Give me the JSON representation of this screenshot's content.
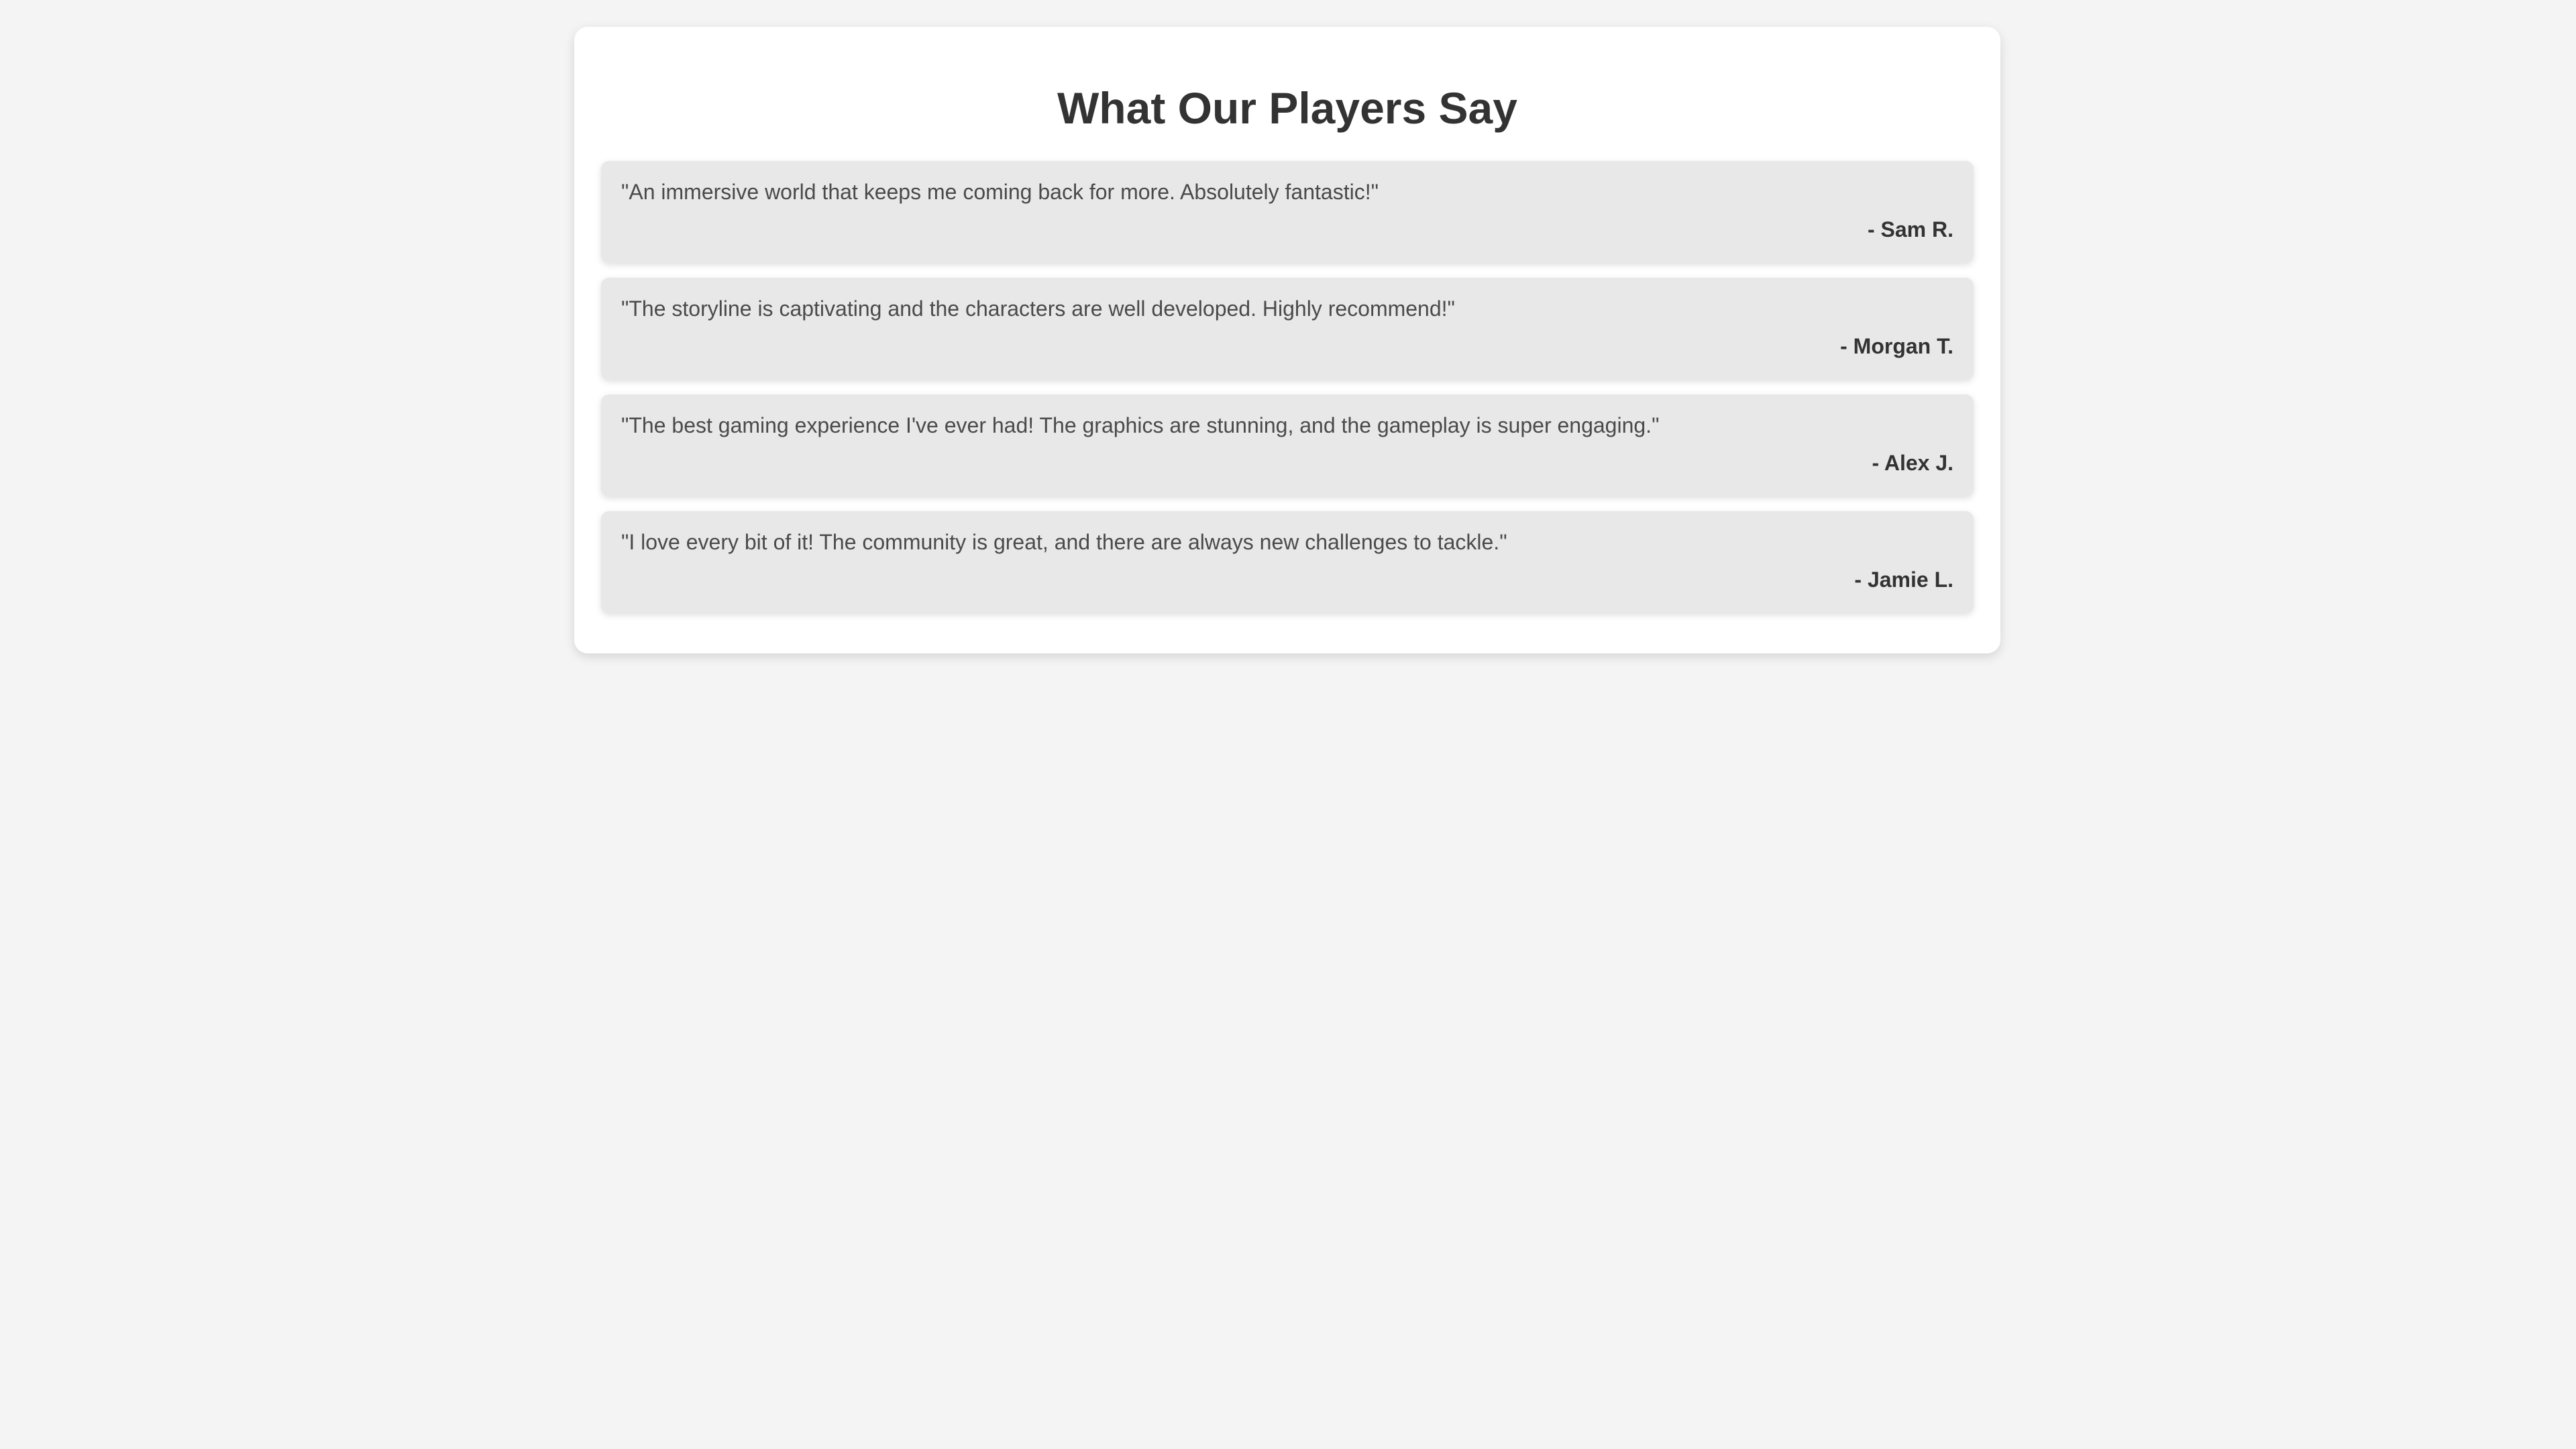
{
  "page": {
    "title": "What Our Players Say"
  },
  "testimonials": [
    {
      "quote": "\"An immersive world that keeps me coming back for more. Absolutely fantastic!\"",
      "author": "- Sam R."
    },
    {
      "quote": "\"The storyline is captivating and the characters are well developed. Highly recommend!\"",
      "author": "- Morgan T."
    },
    {
      "quote": "\"The best gaming experience I've ever had! The graphics are stunning, and the gameplay is super engaging.\"",
      "author": "- Alex J."
    },
    {
      "quote": "\"I love every bit of it! The community is great, and there are always new challenges to tackle.\"",
      "author": "- Jamie L."
    }
  ],
  "colors": {
    "page_background": "#f4f4f4",
    "card_background": "#ffffff",
    "testimonial_background": "#e8e8e8",
    "heading_text": "#333333",
    "body_text": "#4a4a4a"
  }
}
